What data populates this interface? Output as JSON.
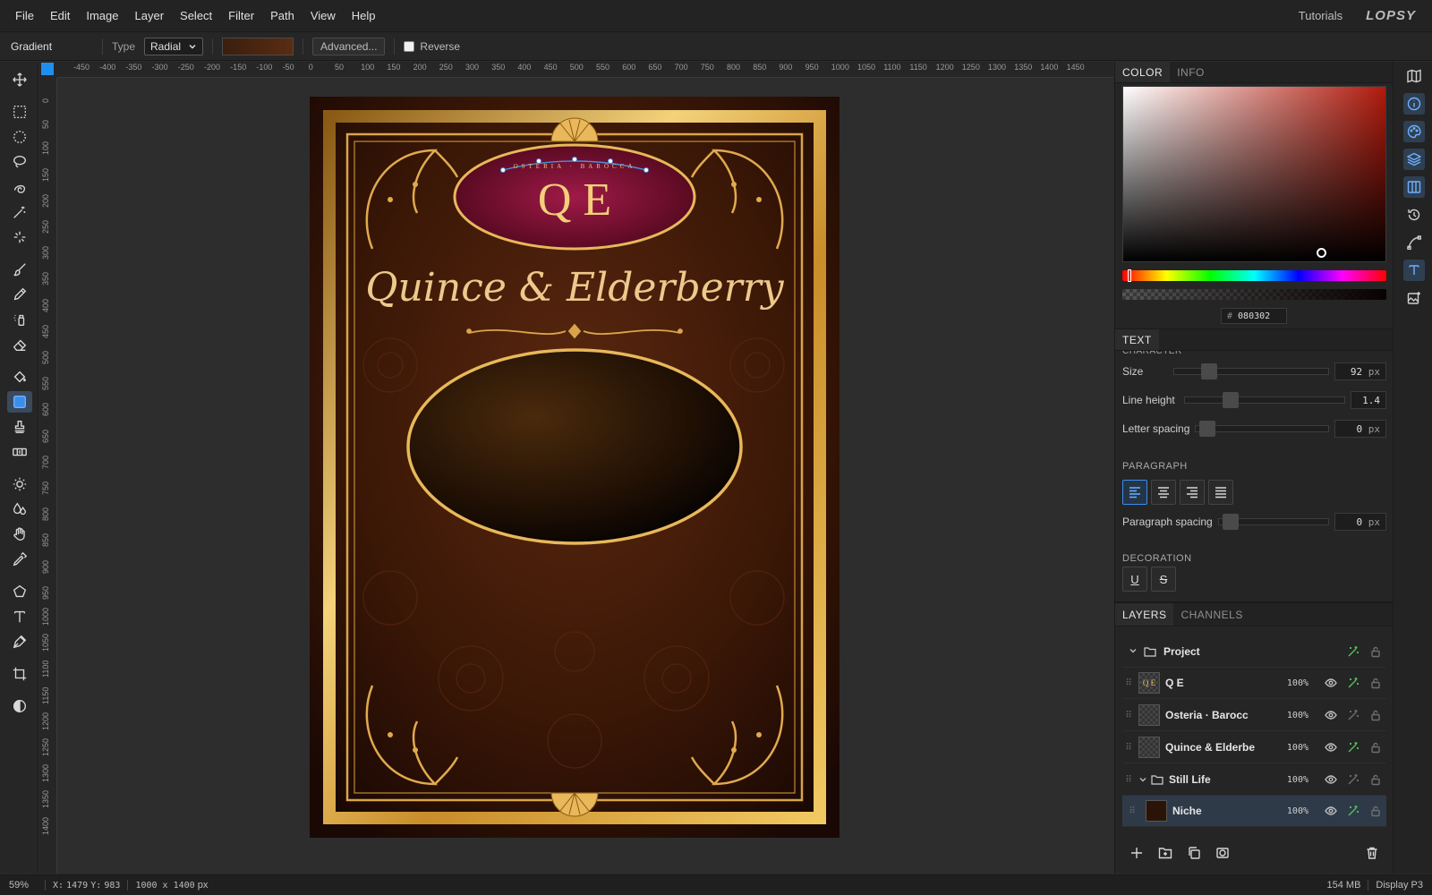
{
  "menubar": {
    "items": [
      "File",
      "Edit",
      "Image",
      "Layer",
      "Select",
      "Filter",
      "Path",
      "View",
      "Help"
    ],
    "tutorials": "Tutorials",
    "logo": "LOPSY"
  },
  "options": {
    "tool_name": "Gradient",
    "type_label": "Type",
    "type_value": "Radial",
    "advanced_label": "Advanced...",
    "reverse_label": "Reverse"
  },
  "ruler": {
    "top": [
      "-450",
      "-400",
      "-350",
      "-300",
      "-250",
      "-200",
      "-150",
      "-100",
      "-50",
      "0",
      "50",
      "100",
      "150",
      "200",
      "250",
      "300",
      "350",
      "400",
      "450",
      "500",
      "550",
      "600",
      "650",
      "700",
      "750",
      "800",
      "850",
      "900",
      "950",
      "1000",
      "1050",
      "1100",
      "1150",
      "1200",
      "1250",
      "1300",
      "1350",
      "1400",
      "1450"
    ],
    "left": [
      "0",
      "50",
      "100",
      "150",
      "200",
      "250",
      "300",
      "350",
      "400",
      "450",
      "500",
      "550",
      "600",
      "650",
      "700",
      "750",
      "800",
      "850",
      "900",
      "950",
      "1000",
      "1050",
      "1100",
      "1150",
      "1200",
      "1250",
      "1300",
      "1350",
      "1400"
    ]
  },
  "artwork": {
    "monogram": "Q E",
    "arc_text": "OSTERIA · BAROCCA",
    "title": "Quince & Elderberry"
  },
  "color_panel": {
    "tabs": [
      "COLOR",
      "INFO"
    ],
    "hex_label": "#",
    "hex": "080302"
  },
  "text_panel": {
    "tab": "TEXT",
    "character_title": "CHARACTER",
    "size_label": "Size",
    "size_value": "92",
    "size_unit": "px",
    "line_height_label": "Line height",
    "line_height_value": "1.4",
    "letter_spacing_label": "Letter spacing",
    "letter_spacing_value": "0",
    "letter_spacing_unit": "px",
    "paragraph_title": "PARAGRAPH",
    "paragraph_spacing_label": "Paragraph spacing",
    "paragraph_spacing_value": "0",
    "paragraph_spacing_unit": "px",
    "decoration_title": "DECORATION",
    "underline_label": "U",
    "strike_label": "S"
  },
  "layers_panel": {
    "tabs": [
      "LAYERS",
      "CHANNELS"
    ],
    "layers": [
      {
        "name": "Project",
        "opacity": ""
      },
      {
        "name": "Q E",
        "opacity": "100%"
      },
      {
        "name": "Osteria · Barocc",
        "opacity": "100%"
      },
      {
        "name": "Quince & Elderbe",
        "opacity": "100%"
      },
      {
        "name": "Still Life",
        "opacity": "100%"
      },
      {
        "name": "Niche",
        "opacity": "100%"
      }
    ]
  },
  "status": {
    "zoom": "59%",
    "x_label": "X:",
    "x": "1479",
    "y_label": "Y:",
    "y": "983",
    "doc_size": "1000 x 1400",
    "doc_unit": "px",
    "memory": "154 MB",
    "color_profile": "Display P3"
  },
  "colors": {
    "accent": "#3b8eea",
    "gold": "#d8a94a",
    "burgundy": "#7a0f2e",
    "background": "#3a1808"
  }
}
